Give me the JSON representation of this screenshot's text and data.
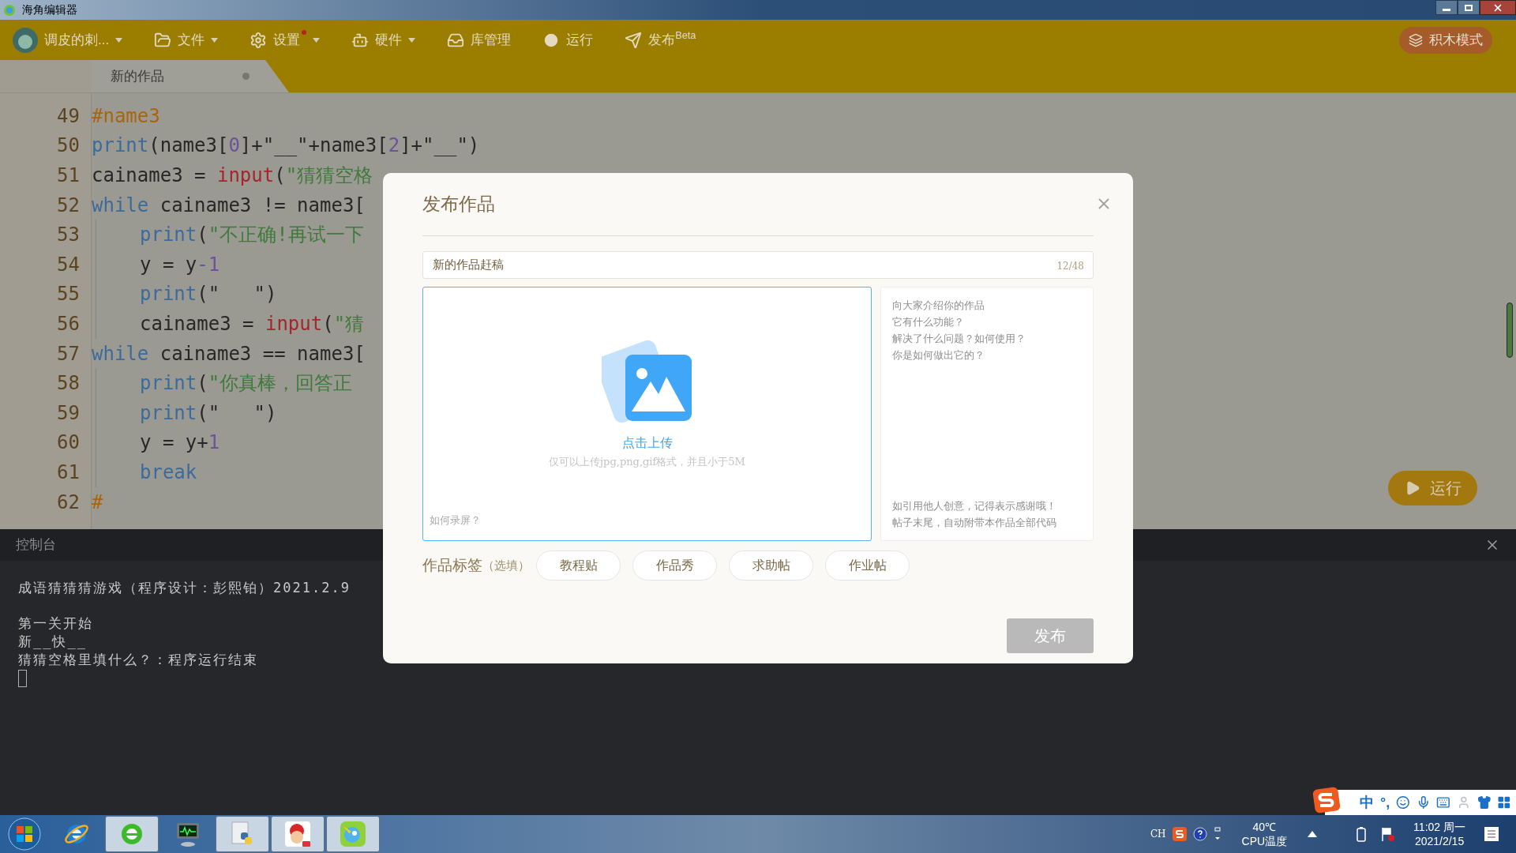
{
  "title_bar": {
    "title": "海角编辑器"
  },
  "toolbar": {
    "user": "调皮的刺...",
    "menus": [
      {
        "label": "文件",
        "dropdown": true,
        "notification": false
      },
      {
        "label": "设置",
        "dropdown": true,
        "notification": true
      },
      {
        "label": "硬件",
        "dropdown": true,
        "notification": false
      },
      {
        "label": "库管理",
        "dropdown": false,
        "notification": false
      },
      {
        "label": "运行",
        "dropdown": false,
        "notification": false
      },
      {
        "label": "发布$^{Beta}$",
        "dropdown": false,
        "notification": false
      }
    ],
    "block_mode_button": "积木模式"
  },
  "tabs": [
    {
      "label": "新的作品",
      "selected": true,
      "modified": true
    }
  ],
  "editor": {
    "lines": [
      {
        "number": "49",
        "indented": false,
        "tokens": [
          {
            "kind": "comment",
            "text": "#name3"
          }
        ]
      },
      {
        "number": "50",
        "indented": false,
        "tokens": [
          {
            "kind": "keyword",
            "text": "print"
          },
          {
            "kind": "plain",
            "text": "(name3["
          },
          {
            "kind": "number",
            "text": "0"
          },
          {
            "kind": "plain",
            "text": "]+\"__\"+name3["
          },
          {
            "kind": "number",
            "text": "2"
          },
          {
            "kind": "plain",
            "text": "]+\"__\")"
          }
        ]
      },
      {
        "number": "51",
        "indented": false,
        "tokens": [
          {
            "kind": "plain",
            "text": "cainame3 = "
          },
          {
            "kind": "builtin",
            "text": "input"
          },
          {
            "kind": "plain",
            "text": "("
          },
          {
            "kind": "string",
            "text": "\"猜猜空格"
          }
        ]
      },
      {
        "number": "52",
        "indented": false,
        "tokens": [
          {
            "kind": "keyword",
            "text": "while"
          },
          {
            "kind": "plain",
            "text": " cainame3 != name3["
          }
        ]
      },
      {
        "number": "53",
        "indented": true,
        "tokens": [
          {
            "kind": "keyword",
            "text": "print"
          },
          {
            "kind": "plain",
            "text": "("
          },
          {
            "kind": "string",
            "text": "\"不正确!再试一下"
          }
        ]
      },
      {
        "number": "54",
        "indented": true,
        "tokens": [
          {
            "kind": "plain",
            "text": "y = y"
          },
          {
            "kind": "number",
            "text": "-1"
          }
        ]
      },
      {
        "number": "55",
        "indented": true,
        "tokens": [
          {
            "kind": "keyword",
            "text": "print"
          },
          {
            "kind": "plain",
            "text": "(\"   \")"
          }
        ]
      },
      {
        "number": "56",
        "indented": true,
        "tokens": [
          {
            "kind": "plain",
            "text": "cainame3 = "
          },
          {
            "kind": "builtin",
            "text": "input"
          },
          {
            "kind": "plain",
            "text": "("
          },
          {
            "kind": "string",
            "text": "\"猜"
          }
        ]
      },
      {
        "number": "57",
        "indented": false,
        "tokens": [
          {
            "kind": "keyword",
            "text": "while"
          },
          {
            "kind": "plain",
            "text": " cainame3 == name3["
          }
        ]
      },
      {
        "number": "58",
        "indented": true,
        "tokens": [
          {
            "kind": "keyword",
            "text": "print"
          },
          {
            "kind": "plain",
            "text": "("
          },
          {
            "kind": "string",
            "text": "\"你真棒，回答正"
          }
        ]
      },
      {
        "number": "59",
        "indented": true,
        "tokens": [
          {
            "kind": "keyword",
            "text": "print"
          },
          {
            "kind": "plain",
            "text": "(\"   \")"
          }
        ]
      },
      {
        "number": "60",
        "indented": true,
        "tokens": [
          {
            "kind": "plain",
            "text": "y = y+"
          },
          {
            "kind": "number",
            "text": "1"
          }
        ]
      },
      {
        "number": "61",
        "indented": true,
        "tokens": [
          {
            "kind": "keyword",
            "text": "break"
          }
        ]
      },
      {
        "number": "62",
        "indented": false,
        "tokens": [
          {
            "kind": "comment",
            "text": "#"
          }
        ]
      }
    ]
  },
  "run_button": "运行",
  "console": {
    "title": "控制台",
    "banner": "成语猜猜猜游戏（程序设计：彭熙铂）2021.2.9",
    "lines": [
      "第一关开始",
      "新__快__",
      "猜猜空格里填什么？：程序运行结束"
    ]
  },
  "dialog": {
    "title": "发布作品",
    "title_field": {
      "value": "新的作品赶稿",
      "counter": "12/48"
    },
    "upload": {
      "label": "点击上传",
      "hint": "仅可以上传jpg,png,gif格式，并且小于5M",
      "link": "如何录屏？"
    },
    "description": {
      "placeholder_lines": [
        "向大家介绍你的作品",
        "它有什么功能？",
        "解决了什么问题？如何使用？",
        "你是如何做出它的？"
      ],
      "note_lines": [
        "如引用他人创意，记得表示感谢哦！",
        "帖子末尾，自动附带本作品全部代码"
      ]
    },
    "tags": {
      "label": "作品标签",
      "optional": "（选填）",
      "items": [
        {
          "label": "教程贴",
          "selected": false
        },
        {
          "label": "作品秀",
          "selected": false
        },
        {
          "label": "求助帖",
          "selected": false
        },
        {
          "label": "作业帖",
          "selected": false
        }
      ]
    },
    "submit": {
      "label": "发布",
      "disabled": true
    }
  },
  "ime_bar": {
    "mode": "中",
    "punctuation": "°,"
  },
  "taskbar": {
    "apps": [
      {
        "running": false
      },
      {
        "running": true
      },
      {
        "running": false
      },
      {
        "running": true
      },
      {
        "running": true
      },
      {
        "running": true
      }
    ],
    "language": "CH",
    "temperature": "40℃",
    "temperature_label": "CPU温度",
    "time": "11:02 周一",
    "date": "2021/2/15"
  }
}
